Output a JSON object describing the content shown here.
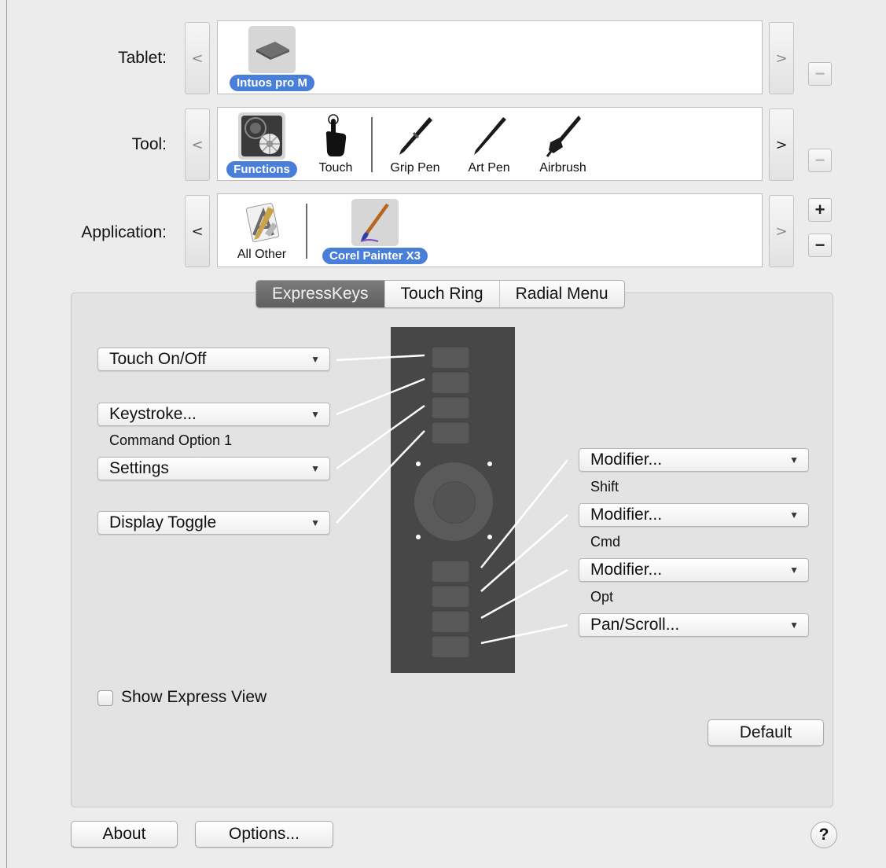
{
  "rows": {
    "tablet": {
      "label": "Tablet:",
      "items": [
        {
          "name": "Intuos pro M",
          "selected": true
        }
      ]
    },
    "tool": {
      "label": "Tool:",
      "items": [
        {
          "name": "Functions",
          "selected": true
        },
        {
          "name": "Touch",
          "selected": false
        },
        {
          "name": "Grip Pen",
          "selected": false
        },
        {
          "name": "Art Pen",
          "selected": false
        },
        {
          "name": "Airbrush",
          "selected": false
        }
      ]
    },
    "application": {
      "label": "Application:",
      "items": [
        {
          "name": "All Other",
          "selected": false
        },
        {
          "name": "Corel Painter X3",
          "selected": true
        }
      ]
    }
  },
  "nav": {
    "prev": "<",
    "next": ">"
  },
  "row_buttons": {
    "add": "+",
    "remove": "−"
  },
  "tabs": [
    {
      "label": "ExpressKeys",
      "active": true
    },
    {
      "label": "Touch Ring",
      "active": false
    },
    {
      "label": "Radial Menu",
      "active": false
    }
  ],
  "left_keys": [
    {
      "value": "Touch On/Off",
      "sublabel": ""
    },
    {
      "value": "Keystroke...",
      "sublabel": "Command Option 1"
    },
    {
      "value": "Settings",
      "sublabel": ""
    },
    {
      "value": "Display Toggle",
      "sublabel": ""
    }
  ],
  "right_keys": [
    {
      "value": "Modifier...",
      "sublabel": "Shift"
    },
    {
      "value": "Modifier...",
      "sublabel": "Cmd"
    },
    {
      "value": "Modifier...",
      "sublabel": "Opt"
    },
    {
      "value": "Pan/Scroll...",
      "sublabel": ""
    }
  ],
  "caret": "▼",
  "show_express_view": {
    "label": "Show Express View",
    "checked": false
  },
  "buttons": {
    "default": "Default",
    "about": "About",
    "options": "Options...",
    "help": "?"
  },
  "colors": {
    "accent": "#4a7fd9",
    "device": "#474747",
    "active_tab": "#6a6a6a"
  }
}
